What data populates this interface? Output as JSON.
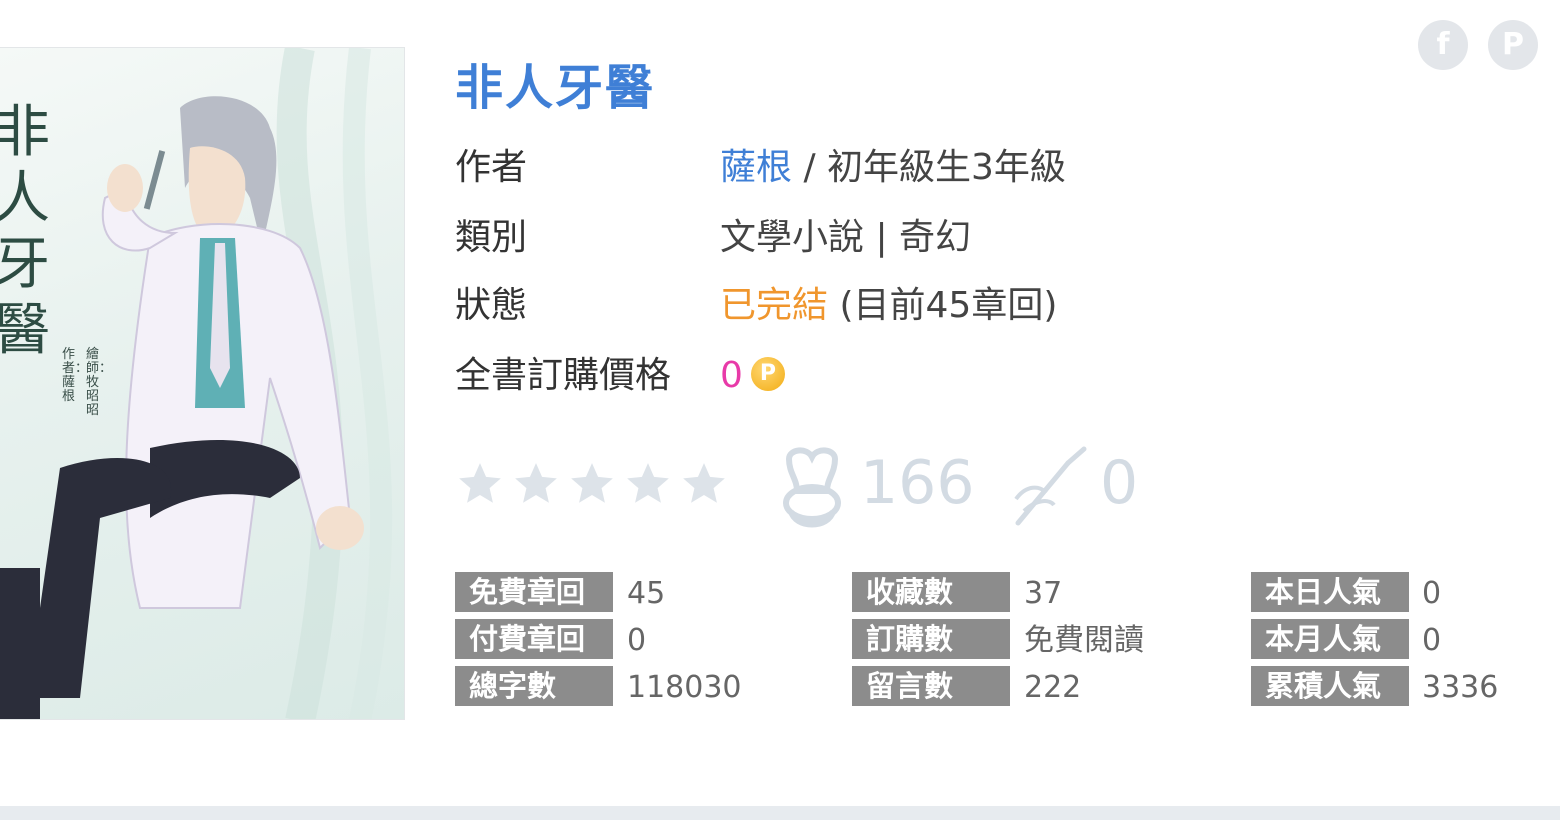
{
  "book": {
    "title": "非人牙醫",
    "cover": {
      "title_text": "非人牙醫",
      "credit_illustrator": "繪師：牧昭昭",
      "credit_author": "作者：薩根"
    }
  },
  "info": {
    "author_label": "作者",
    "author_name": "薩根",
    "author_rank": " / 初年級生3年級",
    "category_label": "類別",
    "category_value": "文學小說 | 奇幻",
    "status_label": "狀態",
    "status_value": "已完結",
    "status_detail": " (目前45章回)",
    "price_label": "全書訂購價格",
    "price_value": "0",
    "price_coin_symbol": "P"
  },
  "rating": {
    "stars_filled": 0,
    "stars_total": 5,
    "likes_count": "166",
    "dislikes_count": "0"
  },
  "social": {
    "facebook_symbol": "f",
    "plurk_symbol": "P"
  },
  "stats": {
    "col1": [
      {
        "label": "免費章回",
        "value": "45"
      },
      {
        "label": "付費章回",
        "value": "0"
      },
      {
        "label": "總字數",
        "value": "118030"
      }
    ],
    "col2": [
      {
        "label": "收藏數",
        "value": "37"
      },
      {
        "label": "訂購數",
        "value": "免費閱讀"
      },
      {
        "label": "留言數",
        "value": "222"
      }
    ],
    "col3": [
      {
        "label": "本日人氣",
        "value": "0"
      },
      {
        "label": "本月人氣",
        "value": "0"
      },
      {
        "label": "累積人氣",
        "value": "3336"
      }
    ]
  },
  "colors": {
    "title_blue": "#3f7fd6",
    "status_orange": "#f0962d",
    "price_pink": "#e83aa8",
    "stat_label_bg": "#8c8c8c",
    "icon_gray": "#d3dbe3"
  }
}
